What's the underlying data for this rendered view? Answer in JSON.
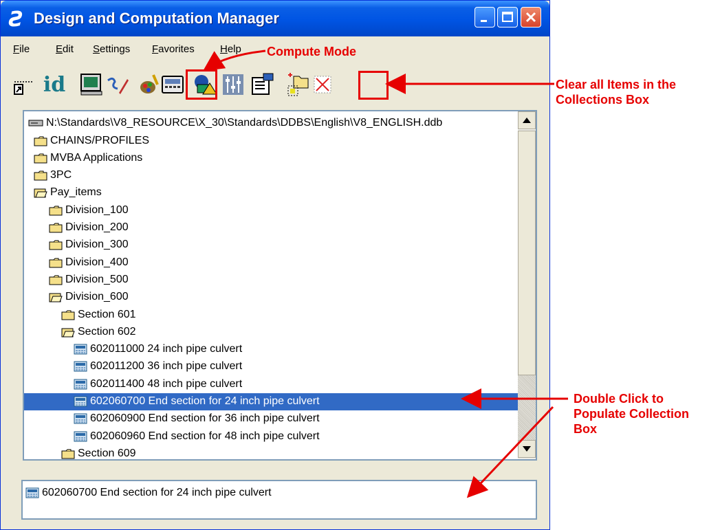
{
  "window": {
    "title": "Design and Computation Manager",
    "title_icon": "Ƨ"
  },
  "menu": [
    {
      "label": "File"
    },
    {
      "label": "Edit"
    },
    {
      "label": "Settings"
    },
    {
      "label": "Favorites"
    },
    {
      "label": "Help"
    }
  ],
  "toolbar": {
    "id_label": "id",
    "buttons": [
      "place-icon",
      "id-icon",
      "monitor-icon",
      "pencil-icon",
      "palette-icon",
      "compute-icon",
      "shapes-icon",
      "tune-icon",
      "properties-icon",
      "new-folder-icon",
      "clear-collection-icon"
    ]
  },
  "tree": {
    "root": "N:\\Standards\\V8_RESOURCE\\X_30\\Standards\\DDBS\\English\\V8_ENGLISH.ddb",
    "items": [
      {
        "label": "CHAINS/PROFILES",
        "icon": "folder-icon"
      },
      {
        "label": "MVBA Applications",
        "icon": "folder-icon"
      },
      {
        "label": "3PC",
        "icon": "folder-icon"
      },
      {
        "label": "Pay_items",
        "icon": "folder-open-icon"
      },
      {
        "label": "Division_100",
        "icon": "folder-icon"
      },
      {
        "label": "Division_200",
        "icon": "folder-icon"
      },
      {
        "label": "Division_300",
        "icon": "folder-icon"
      },
      {
        "label": "Division_400",
        "icon": "folder-icon"
      },
      {
        "label": "Division_500",
        "icon": "folder-icon"
      },
      {
        "label": "Division_600",
        "icon": "folder-open-icon"
      },
      {
        "label": "Section 601",
        "icon": "folder-icon"
      },
      {
        "label": "Section 602",
        "icon": "folder-open-icon"
      },
      {
        "label": "602011000 24 inch pipe culvert",
        "icon": "item-icon"
      },
      {
        "label": "602011200 36 inch pipe culvert",
        "icon": "item-icon"
      },
      {
        "label": "602011400 48 inch pipe culvert",
        "icon": "item-icon"
      },
      {
        "label": "602060700 End section for 24 inch pipe culvert",
        "icon": "item-icon",
        "selected": true
      },
      {
        "label": "602060900 End section for 36 inch pipe culvert",
        "icon": "item-icon"
      },
      {
        "label": "602060960 End section for 48 inch pipe culvert",
        "icon": "item-icon"
      },
      {
        "label": "Section 609",
        "icon": "folder-icon"
      }
    ]
  },
  "collection": {
    "item": "602060700 End section for 24 inch pipe culvert"
  },
  "annotations": {
    "compute_mode": "Compute Mode",
    "clear_items_line1": "Clear all Items in the",
    "clear_items_line2": "Collections Box",
    "double_click_line1": "Double Click to",
    "double_click_line2": "Populate Collection",
    "double_click_line3": "Box"
  },
  "colors": {
    "annotation": "#e60000",
    "selection": "#316ac5",
    "titlebar": "#0054e3"
  }
}
